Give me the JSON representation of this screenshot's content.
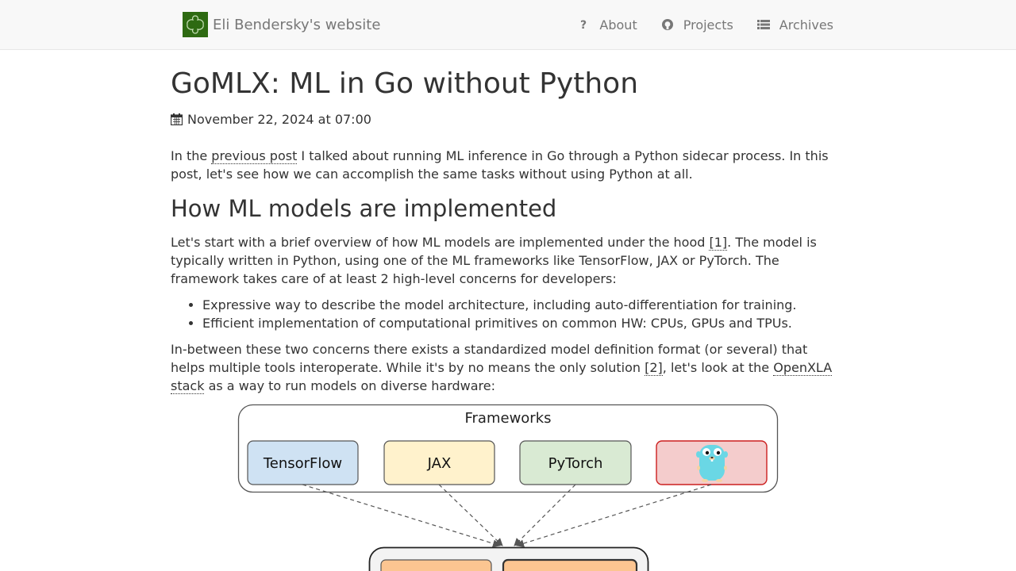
{
  "site": {
    "title": "Eli Bendersky's website"
  },
  "nav": {
    "items": [
      {
        "label": "About",
        "icon": "question-icon"
      },
      {
        "label": "Projects",
        "icon": "github-icon"
      },
      {
        "label": "Archives",
        "icon": "list-icon"
      }
    ]
  },
  "post": {
    "title": "GoMLX: ML in Go without Python",
    "date": "November 22, 2024 at 07:00",
    "p1": {
      "a": "In the ",
      "link": "previous post",
      "b": " I talked about running ML inference in Go through a Python sidecar process. In this post, let's see how we can accomplish the same tasks without using Python at all."
    },
    "h2": "How ML models are implemented",
    "p2": {
      "a": "Let's start with a brief overview of how ML models are implemented under the hood ",
      "fn": "[1]",
      "b": ". The model is typically written in Python, using one of the ML frameworks like TensorFlow, JAX or PyTorch. The framework takes care of at least 2 high-level concerns for developers:"
    },
    "bullets": [
      "Expressive way to describe the model architecture, including auto-differentiation for training.",
      "Efficient implementation of computational primitives on common HW: CPUs, GPUs and TPUs."
    ],
    "p3": {
      "a": "In-between these two concerns there exists a standardized model definition format (or several) that helps multiple tools interoperate. While it's by no means the only solution ",
      "fn": "[2]",
      "b": ", let's look at the ",
      "link": "OpenXLA stack",
      "c": " as a way to run models on diverse hardware:"
    }
  },
  "diagram": {
    "group_label": "Frameworks",
    "boxes": [
      {
        "label": "TensorFlow",
        "color": "#cfe2f3"
      },
      {
        "label": "JAX",
        "color": "#fff2cc"
      },
      {
        "label": "PyTorch",
        "color": "#d9ead3"
      },
      {
        "label": "",
        "color": "#f4cccc",
        "icon": "gopher-icon"
      }
    ]
  }
}
